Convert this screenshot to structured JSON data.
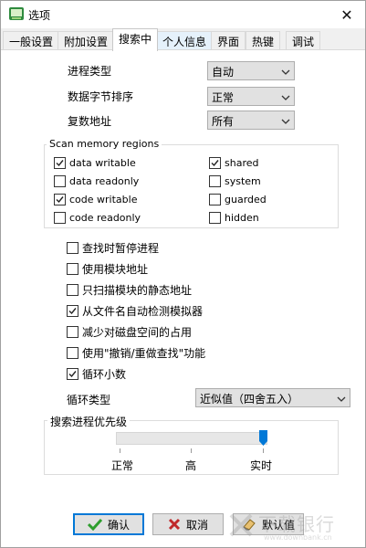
{
  "window": {
    "title": "选项",
    "close": "✕"
  },
  "tabs": [
    {
      "label": "一般设置"
    },
    {
      "label": "附加设置"
    },
    {
      "label": "搜索中"
    },
    {
      "label": "个人信息"
    },
    {
      "label": "界面"
    },
    {
      "label": "热键"
    },
    {
      "label": "调试"
    }
  ],
  "fields": {
    "process_type": {
      "label": "进程类型",
      "value": "自动"
    },
    "byte_order": {
      "label": "数据字节排序",
      "value": "正常"
    },
    "copy_address": {
      "label": "复数地址",
      "value": "所有"
    }
  },
  "scan_regions": {
    "title": "Scan memory regions",
    "items": [
      {
        "label": "data writable",
        "checked": true
      },
      {
        "label": "data readonly",
        "checked": false
      },
      {
        "label": "code writable",
        "checked": true
      },
      {
        "label": "code readonly",
        "checked": false
      },
      {
        "label": "shared",
        "checked": true
      },
      {
        "label": "system",
        "checked": false
      },
      {
        "label": "guarded",
        "checked": false
      },
      {
        "label": "hidden",
        "checked": false
      }
    ]
  },
  "options": [
    {
      "label": "查找时暂停进程",
      "checked": false
    },
    {
      "label": "使用模块地址",
      "checked": false
    },
    {
      "label": "只扫描模块的静态地址",
      "checked": false
    },
    {
      "label": "从文件名自动检测模拟器",
      "checked": true
    },
    {
      "label": "减少对磁盘空间的占用",
      "checked": false
    },
    {
      "label": "使用\"撤销/重做查找\"功能",
      "checked": false
    },
    {
      "label": "循环小数",
      "checked": true
    }
  ],
  "rounding": {
    "label": "循环类型",
    "value": "近似值（四舍五入）"
  },
  "priority": {
    "title": "搜索进程优先级",
    "labels": [
      "正常",
      "高",
      "实时"
    ],
    "level": 1.0
  },
  "buttons": {
    "ok": "确认",
    "cancel": "取消",
    "default": "默认值"
  },
  "watermark": {
    "text": "下载银行",
    "url": "www.downbank.cn"
  },
  "colors": {
    "accent": "#0078d7",
    "check_green": "#2e9e2e",
    "cancel_red": "#c0282a"
  }
}
